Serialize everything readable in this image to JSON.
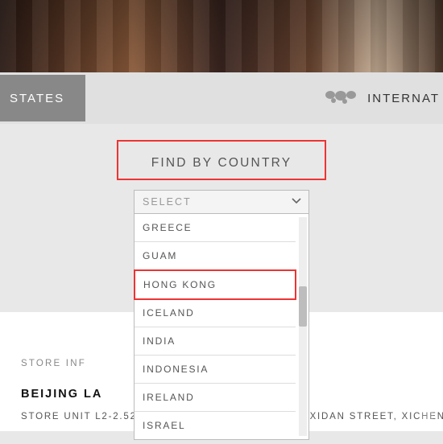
{
  "hero": {
    "alt": "store interior photo"
  },
  "tabs": {
    "left_label": "STATES",
    "right_label": "INTERNAT"
  },
  "find_by_country": {
    "title": "FIND BY COUNTRY",
    "placeholder": "SELECT",
    "options": [
      {
        "label": "GREECE",
        "highlight": false
      },
      {
        "label": "GUAM",
        "highlight": false
      },
      {
        "label": "HONG KONG",
        "highlight": true
      },
      {
        "label": "ICELAND",
        "highlight": false
      },
      {
        "label": "INDIA",
        "highlight": false
      },
      {
        "label": "INDONESIA",
        "highlight": false
      },
      {
        "label": "IRELAND",
        "highlight": false
      },
      {
        "label": "ISRAEL",
        "highlight": false
      }
    ]
  },
  "store": {
    "info_label": "STORE INF",
    "name": "BEIJING LA",
    "address": "STORE UNIT L2-2.52, LAFAYETTE, NO. 110 NORTH XIDAN STREET, XICHEN"
  },
  "watermark": {
    "text": ""
  }
}
